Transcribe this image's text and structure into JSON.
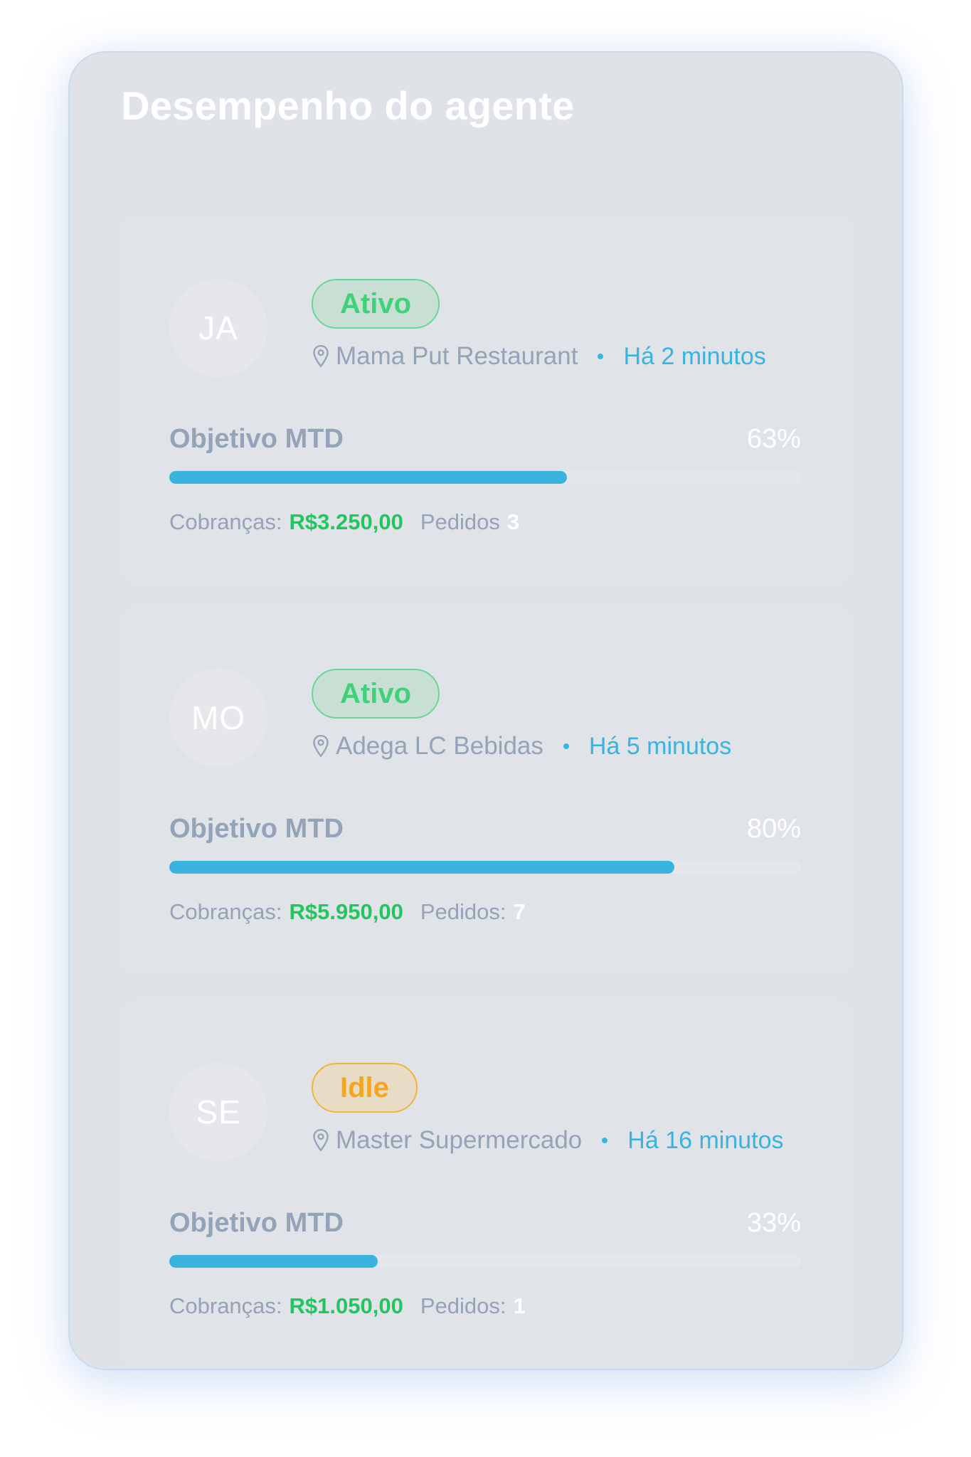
{
  "panel": {
    "title": "Desempenho do agente"
  },
  "agents": [
    {
      "initials": "JA",
      "status": "Ativo",
      "location": "Mama Put Restaurant",
      "last_seen": "Há 2 minutos",
      "goal_label": "Objetivo MTD",
      "goal_percent_text": "63%",
      "goal_progress": 0.63,
      "charges_label": "Cobranças:",
      "charges_value": "R$3.250,00",
      "orders_label": "Pedidos",
      "orders_value": "3"
    },
    {
      "initials": "MO",
      "status": "Ativo",
      "location": "Adega LC Bebidas",
      "last_seen": "Há 5 minutos",
      "goal_label": "Objetivo MTD",
      "goal_percent_text": "80%",
      "goal_progress": 0.8,
      "charges_label": "Cobranças:",
      "charges_value": "R$5.950,00",
      "orders_label": "Pedidos:",
      "orders_value": "7"
    },
    {
      "initials": "SE",
      "status": "Idle",
      "location": "Master Supermercado",
      "last_seen": "Há 16 minutos",
      "goal_label": "Objetivo MTD",
      "goal_percent_text": "33%",
      "goal_progress": 0.33,
      "charges_label": "Cobranças:",
      "charges_value": "R$1.050,00",
      "orders_label": "Pedidos:",
      "orders_value": "1"
    }
  ],
  "colors": {
    "accent": "#3ab4de",
    "active_text": "#3fd27a",
    "idle_text": "#f7a51b",
    "money": "#22c55e"
  },
  "icons": {
    "location": "map-pin-icon"
  }
}
